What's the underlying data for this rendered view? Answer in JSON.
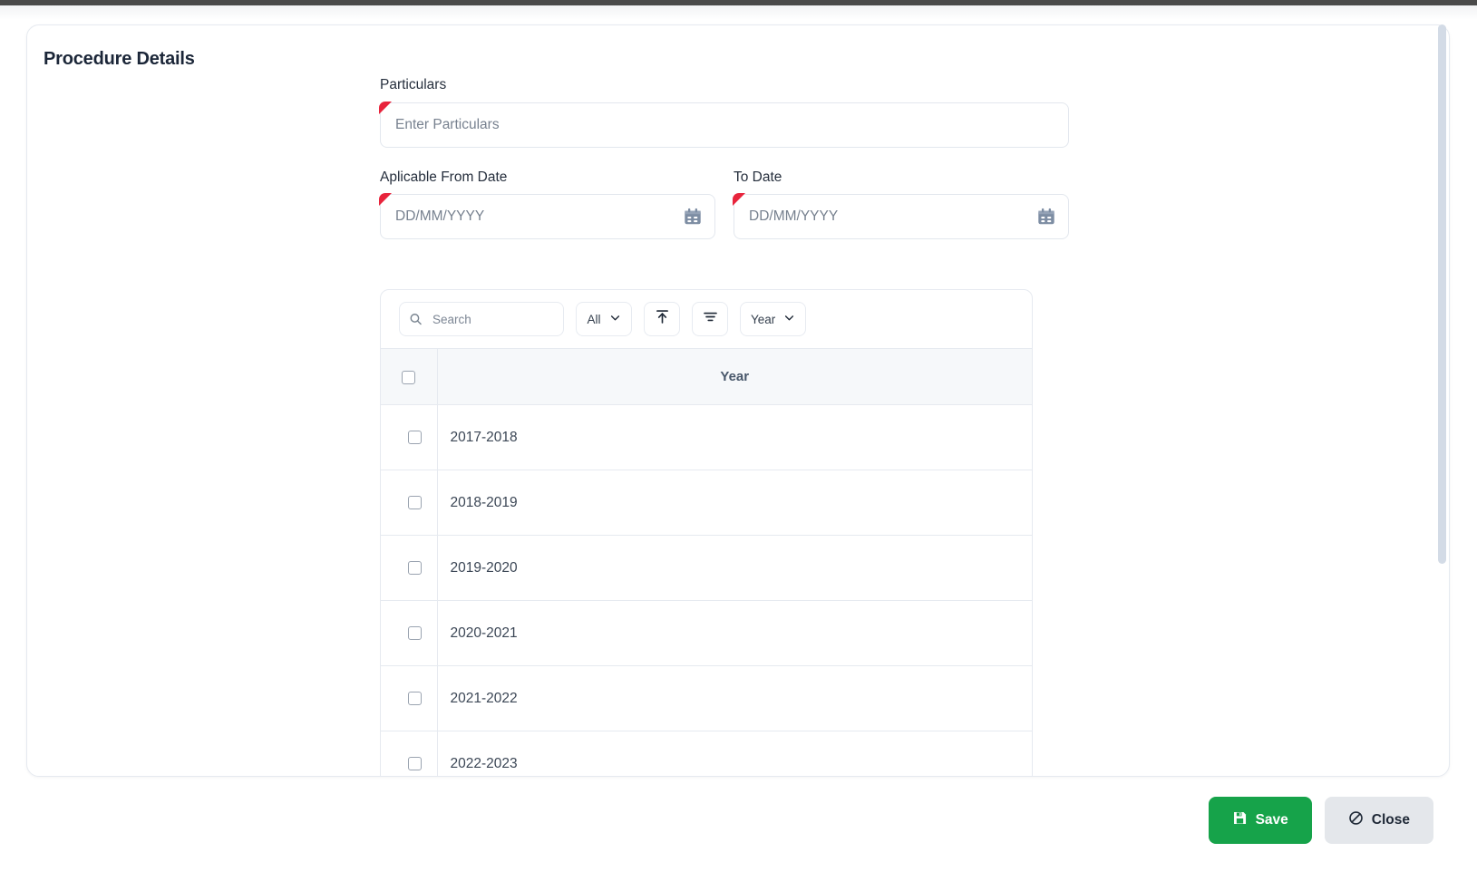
{
  "page": {
    "title": "Procedure Details"
  },
  "form": {
    "particulars": {
      "label": "Particulars",
      "placeholder": "Enter Particulars",
      "value": "",
      "required": true
    },
    "applicable_from_date": {
      "label": "Aplicable From Date",
      "placeholder": "DD/MM/YYYY",
      "value": "",
      "required": true,
      "icon": "calendar-icon"
    },
    "to_date": {
      "label": "To Date",
      "placeholder": "DD/MM/YYYY",
      "value": "",
      "required": true,
      "icon": "calendar-icon"
    }
  },
  "table_toolbar": {
    "search": {
      "placeholder": "Search",
      "value": "",
      "icon": "search-icon"
    },
    "scope_select": {
      "label": "All",
      "icon": "chevron-down-icon"
    },
    "export_button": {
      "icon": "export-up-icon"
    },
    "filter_button": {
      "icon": "filter-icon"
    },
    "column_select": {
      "label": "Year",
      "icon": "chevron-down-icon"
    }
  },
  "table": {
    "select_all_checked": false,
    "columns": [
      "",
      "Year"
    ],
    "header_year": "Year",
    "rows": [
      {
        "year": "2017-2018",
        "checked": false
      },
      {
        "year": "2018-2019",
        "checked": false
      },
      {
        "year": "2019-2020",
        "checked": false
      },
      {
        "year": "2020-2021",
        "checked": false
      },
      {
        "year": "2021-2022",
        "checked": false
      },
      {
        "year": "2022-2023",
        "checked": false
      }
    ]
  },
  "footer": {
    "save_label": "Save",
    "save_icon": "save-disk-icon",
    "close_label": "Close",
    "close_icon": "prohibited-icon"
  },
  "colors": {
    "accent_green": "#16a34a",
    "required_red": "#e8243c",
    "title_text": "#1b2638",
    "border": "#e6eaf0",
    "header_bg": "#f6f8fa",
    "scrollbar": "#d3dbe6",
    "close_bg": "#e4e7eb"
  }
}
